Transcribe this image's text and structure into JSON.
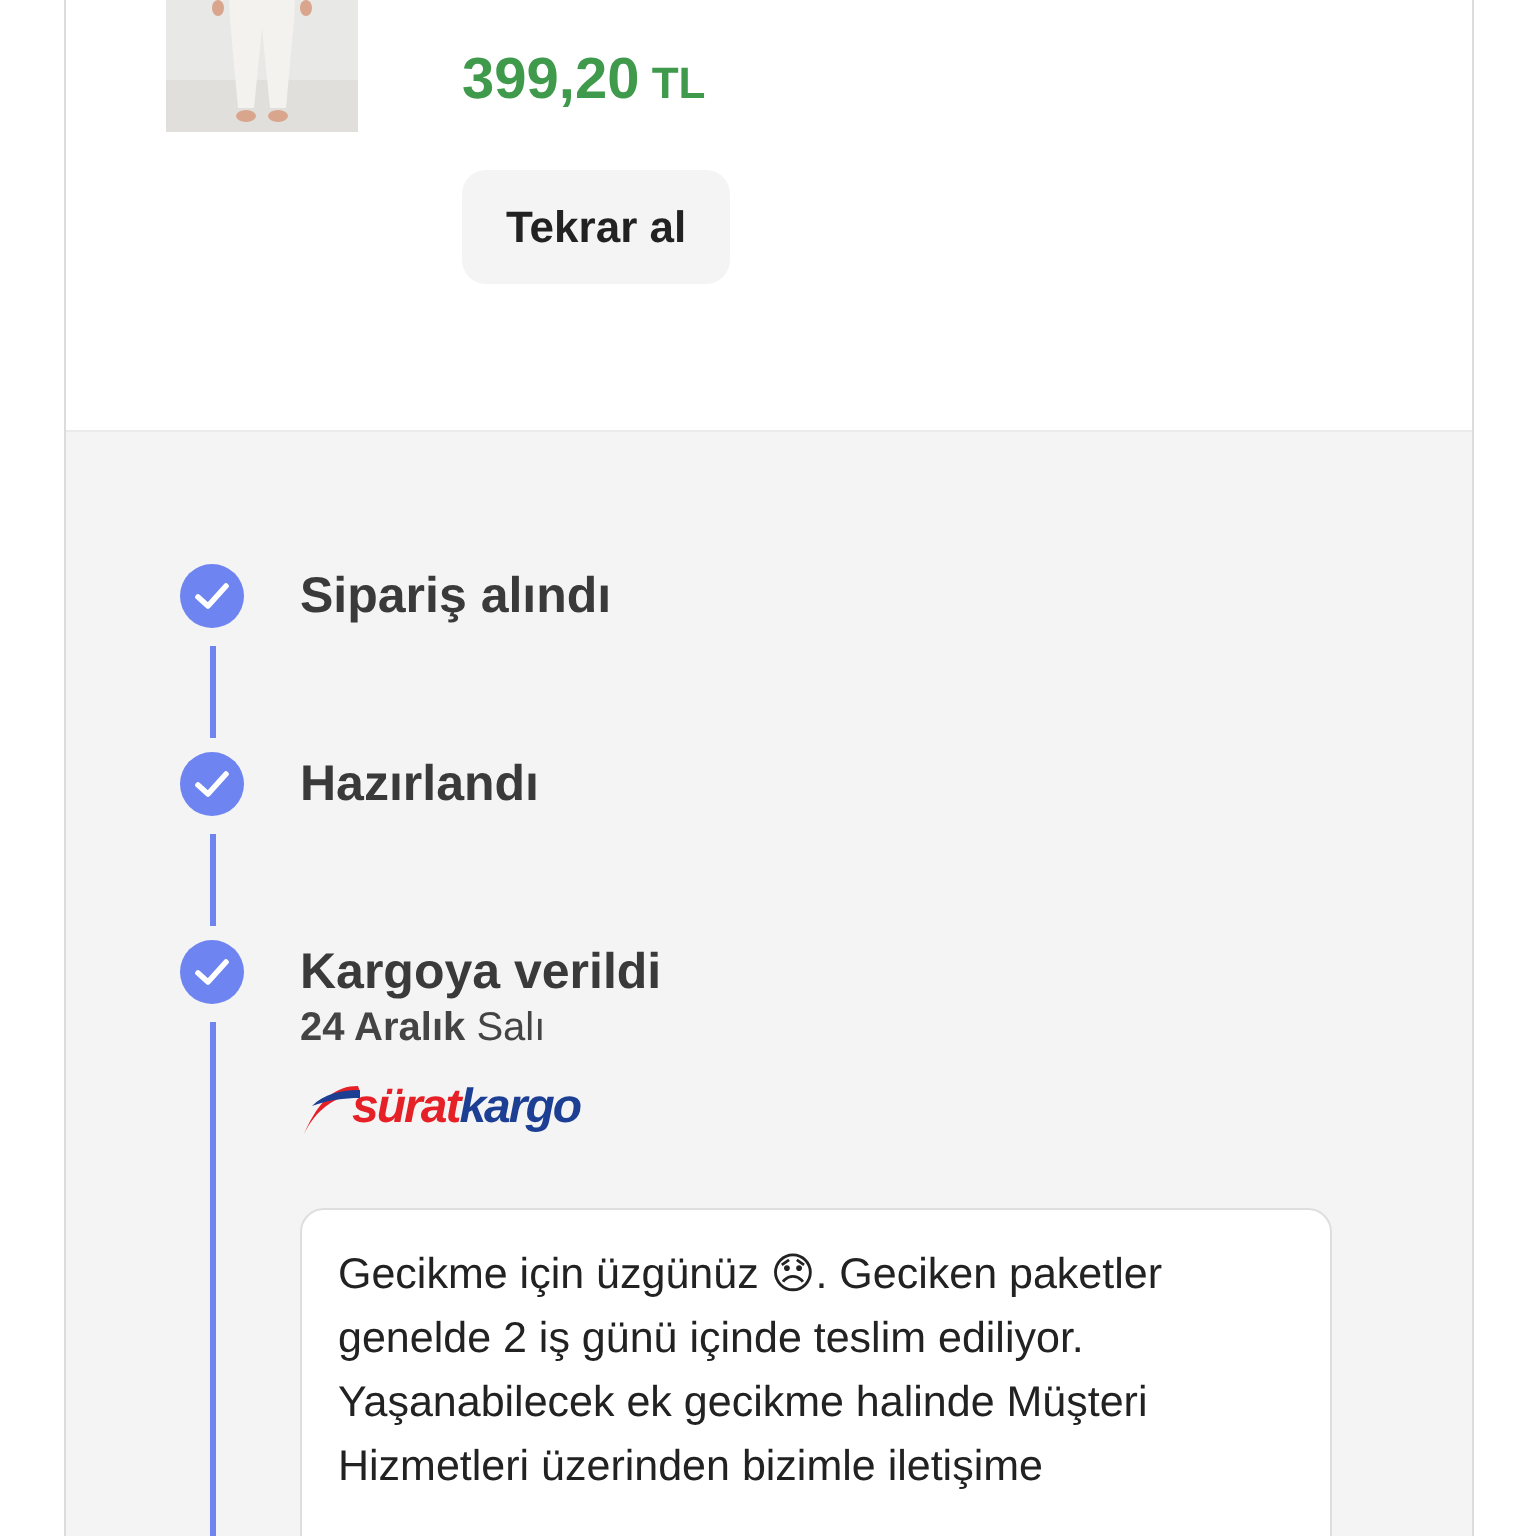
{
  "product": {
    "price": "399,20",
    "currency": "TL",
    "button": "Tekrar al"
  },
  "tracking": {
    "steps": [
      {
        "label": "Sipariş alındı",
        "done": true
      },
      {
        "label": "Hazırlandı",
        "done": true
      },
      {
        "label": "Kargoya verildi",
        "done": true,
        "date": "**24 Aralık** Salı",
        "carrier": {
          "part_1": "sürat",
          "part_2": "kargo"
        },
        "message": "Gecikme için üzgünüz 😞. Geciken paketler genelde 2 iş günü içinde teslim ediliyor. Yaşanabilecek ek gecikme halinde Müşteri Hizmetleri üzerinden bizimle iletişime"
      }
    ]
  }
}
